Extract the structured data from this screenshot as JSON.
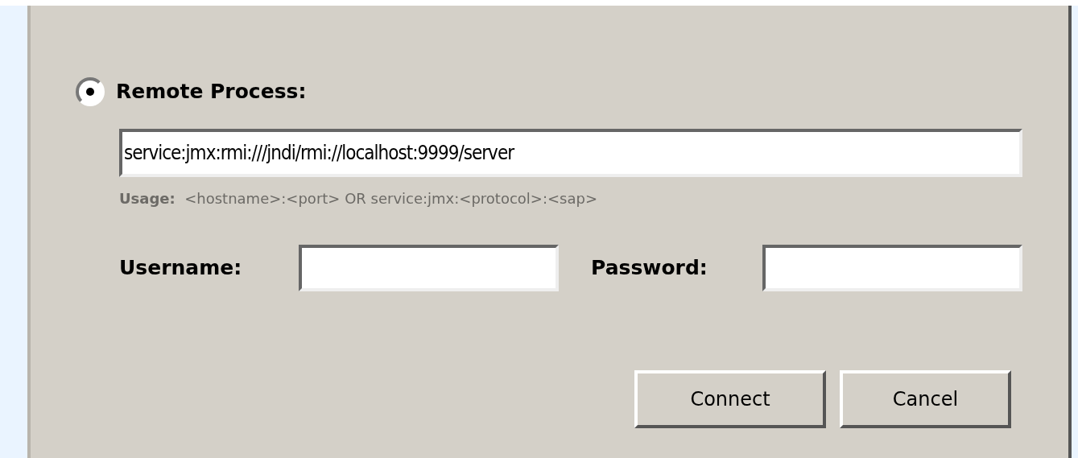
{
  "remote_process": {
    "label": "Remote Process:",
    "selected": true,
    "url_field": {
      "value": "service:jmx:rmi:///jndi/rmi://localhost:9999/server"
    },
    "usage": "**Usage:**  <hostname>:<port> OR service:jmx:<protocol>:<sap>"
  },
  "username": {
    "label": "Username:"
  },
  "password": {
    "label": "Password:"
  },
  "buttons": [
    {
      "label": "Connect"
    },
    {
      "label": "Cancel"
    }
  ]
}
